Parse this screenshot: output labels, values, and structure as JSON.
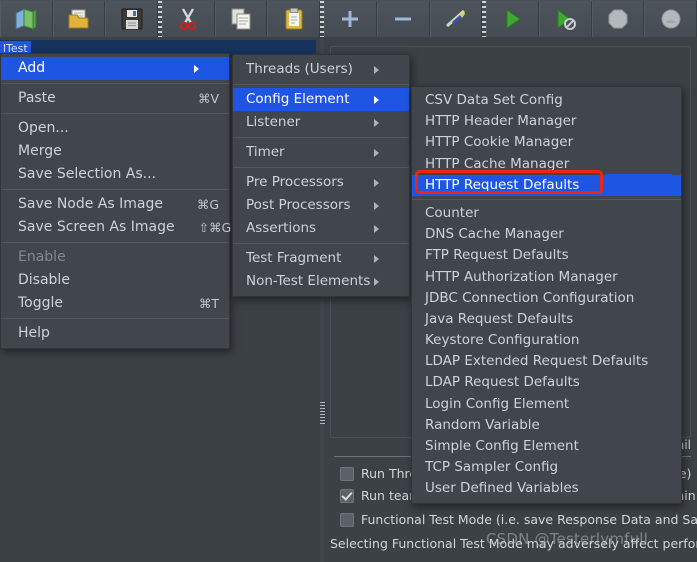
{
  "app": {
    "accent_blue": "#1f55e3",
    "menu_bg": "#41464c",
    "annotation_red": "#f02511",
    "window_bg": "#3c4146"
  },
  "toolbar": {
    "buttons": [
      {
        "name": "new-test-plan",
        "icon": "new-document-icon",
        "glyph": "new"
      },
      {
        "name": "open-test-plan",
        "icon": "open-folder-icon",
        "glyph": "open"
      },
      {
        "name": "save-test-plan",
        "icon": "floppy-save-icon",
        "glyph": "save"
      },
      {
        "name": "cut",
        "icon": "scissors-icon",
        "glyph": "cut"
      },
      {
        "name": "copy",
        "icon": "copy-pages-icon",
        "glyph": "copy"
      },
      {
        "name": "paste",
        "icon": "clipboard-icon",
        "glyph": "paste"
      },
      {
        "name": "expand-all",
        "icon": "plus-icon",
        "glyph": "plus"
      },
      {
        "name": "collapse-all",
        "icon": "minus-icon",
        "glyph": "minus"
      },
      {
        "name": "toggle-enabled",
        "icon": "toggle-pencil-icon",
        "glyph": "toggle"
      },
      {
        "name": "start",
        "icon": "green-play-icon",
        "glyph": "play"
      },
      {
        "name": "start-no-pauses",
        "icon": "green-play-nopause-icon",
        "glyph": "play-alt"
      },
      {
        "name": "stop",
        "icon": "stop-octagon-icon",
        "glyph": "stop"
      },
      {
        "name": "shutdown",
        "icon": "shutdown-circle-icon",
        "glyph": "shutdown"
      }
    ]
  },
  "tree": {
    "selected_label": "lTest"
  },
  "context_menu": {
    "name": "node-context-menu",
    "items": [
      {
        "label": "Add",
        "accel": "",
        "submenu": true,
        "selected": true,
        "disabled": false
      },
      {
        "separator": true
      },
      {
        "label": "Paste",
        "accel": "⌘V",
        "submenu": false,
        "selected": false,
        "disabled": false
      },
      {
        "separator": true
      },
      {
        "label": "Open...",
        "accel": "",
        "submenu": false,
        "selected": false,
        "disabled": false
      },
      {
        "label": "Merge",
        "accel": "",
        "submenu": false,
        "selected": false,
        "disabled": false
      },
      {
        "label": "Save Selection As...",
        "accel": "",
        "submenu": false,
        "selected": false,
        "disabled": false
      },
      {
        "separator": true
      },
      {
        "label": "Save Node As Image",
        "accel": "⌘G",
        "submenu": false,
        "selected": false,
        "disabled": false
      },
      {
        "label": "Save Screen As Image",
        "accel": "⇧⌘G",
        "submenu": false,
        "selected": false,
        "disabled": false
      },
      {
        "separator": true
      },
      {
        "label": "Enable",
        "accel": "",
        "submenu": false,
        "selected": false,
        "disabled": true
      },
      {
        "label": "Disable",
        "accel": "",
        "submenu": false,
        "selected": false,
        "disabled": false
      },
      {
        "label": "Toggle",
        "accel": "⌘T",
        "submenu": false,
        "selected": false,
        "disabled": false
      },
      {
        "separator": true
      },
      {
        "label": "Help",
        "accel": "",
        "submenu": false,
        "selected": false,
        "disabled": false
      }
    ]
  },
  "add_submenu": {
    "name": "add-submenu",
    "items": [
      {
        "label": "Threads (Users)",
        "submenu": true,
        "selected": false
      },
      {
        "separator": true
      },
      {
        "label": "Config Element",
        "submenu": true,
        "selected": true
      },
      {
        "label": "Listener",
        "submenu": true,
        "selected": false
      },
      {
        "separator": true
      },
      {
        "label": "Timer",
        "submenu": true,
        "selected": false
      },
      {
        "separator": true
      },
      {
        "label": "Pre Processors",
        "submenu": true,
        "selected": false
      },
      {
        "label": "Post Processors",
        "submenu": true,
        "selected": false
      },
      {
        "label": "Assertions",
        "submenu": true,
        "selected": false
      },
      {
        "separator": true
      },
      {
        "label": "Test Fragment",
        "submenu": true,
        "selected": false
      },
      {
        "label": "Non-Test Elements",
        "submenu": true,
        "selected": false
      }
    ]
  },
  "config_element_submenu": {
    "name": "config-element-submenu",
    "items": [
      {
        "label": "CSV Data Set Config",
        "selected": false
      },
      {
        "label": "HTTP Header Manager",
        "selected": false
      },
      {
        "label": "HTTP Cookie Manager",
        "selected": false
      },
      {
        "label": "HTTP Cache Manager",
        "selected": false
      },
      {
        "label": "HTTP Request Defaults",
        "selected": true
      },
      {
        "separator": true
      },
      {
        "label": "Counter",
        "selected": false
      },
      {
        "label": "DNS Cache Manager",
        "selected": false
      },
      {
        "label": "FTP Request Defaults",
        "selected": false
      },
      {
        "label": "HTTP Authorization Manager",
        "selected": false
      },
      {
        "label": "JDBC Connection Configuration",
        "selected": false
      },
      {
        "label": "Java Request Defaults",
        "selected": false
      },
      {
        "label": "Keystore Configuration",
        "selected": false
      },
      {
        "label": "LDAP Extended Request Defaults",
        "selected": false
      },
      {
        "label": "LDAP Request Defaults",
        "selected": false
      },
      {
        "label": "Login Config Element",
        "selected": false
      },
      {
        "label": "Random Variable",
        "selected": false
      },
      {
        "label": "Simple Config Element",
        "selected": false
      },
      {
        "label": "TCP Sampler Config",
        "selected": false
      },
      {
        "label": "User Defined Variables",
        "selected": false
      }
    ]
  },
  "right_pane": {
    "detail_text": "etail",
    "checkboxes": [
      {
        "label": "Run Thread Groups consecutively (i.e. one at a time)",
        "checked": false,
        "name": "run-thread-groups-consecutively"
      },
      {
        "label": "Run tearDown Thread Groups after shutdown of main threads",
        "checked": true,
        "name": "run-teardown-thread-groups"
      },
      {
        "label": "Functional Test Mode (i.e. save Response Data and Sampler Data)",
        "checked": false,
        "name": "functional-test-mode"
      }
    ],
    "note": "Selecting Functional Test Mode may adversely affect performance.",
    "watermark": "CSDN @Testerlymfull"
  }
}
